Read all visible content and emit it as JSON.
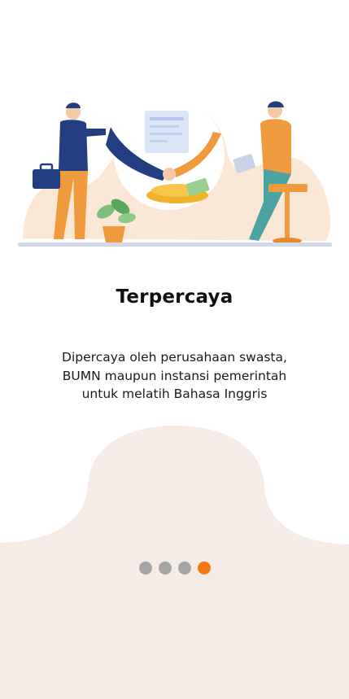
{
  "onboarding": {
    "title": "Terpercaya",
    "description_lines": [
      "Dipercaya oleh perusahaan swasta,",
      "BUMN maupun instansi pemerintah",
      "untuk melatih Bahasa Inggris"
    ]
  },
  "pagination": {
    "total": 4,
    "current": 4,
    "active_color": "#f47a0e",
    "inactive_color": "#a5a5a5"
  },
  "colors": {
    "background": "#ffffff",
    "shape_fill": "#f6ece7",
    "illustration_blob": "#fbe7d6",
    "accent_orange": "#f09a3e",
    "navy": "#233e80"
  },
  "illustration": {
    "subject": "handshake-business-illustration"
  }
}
